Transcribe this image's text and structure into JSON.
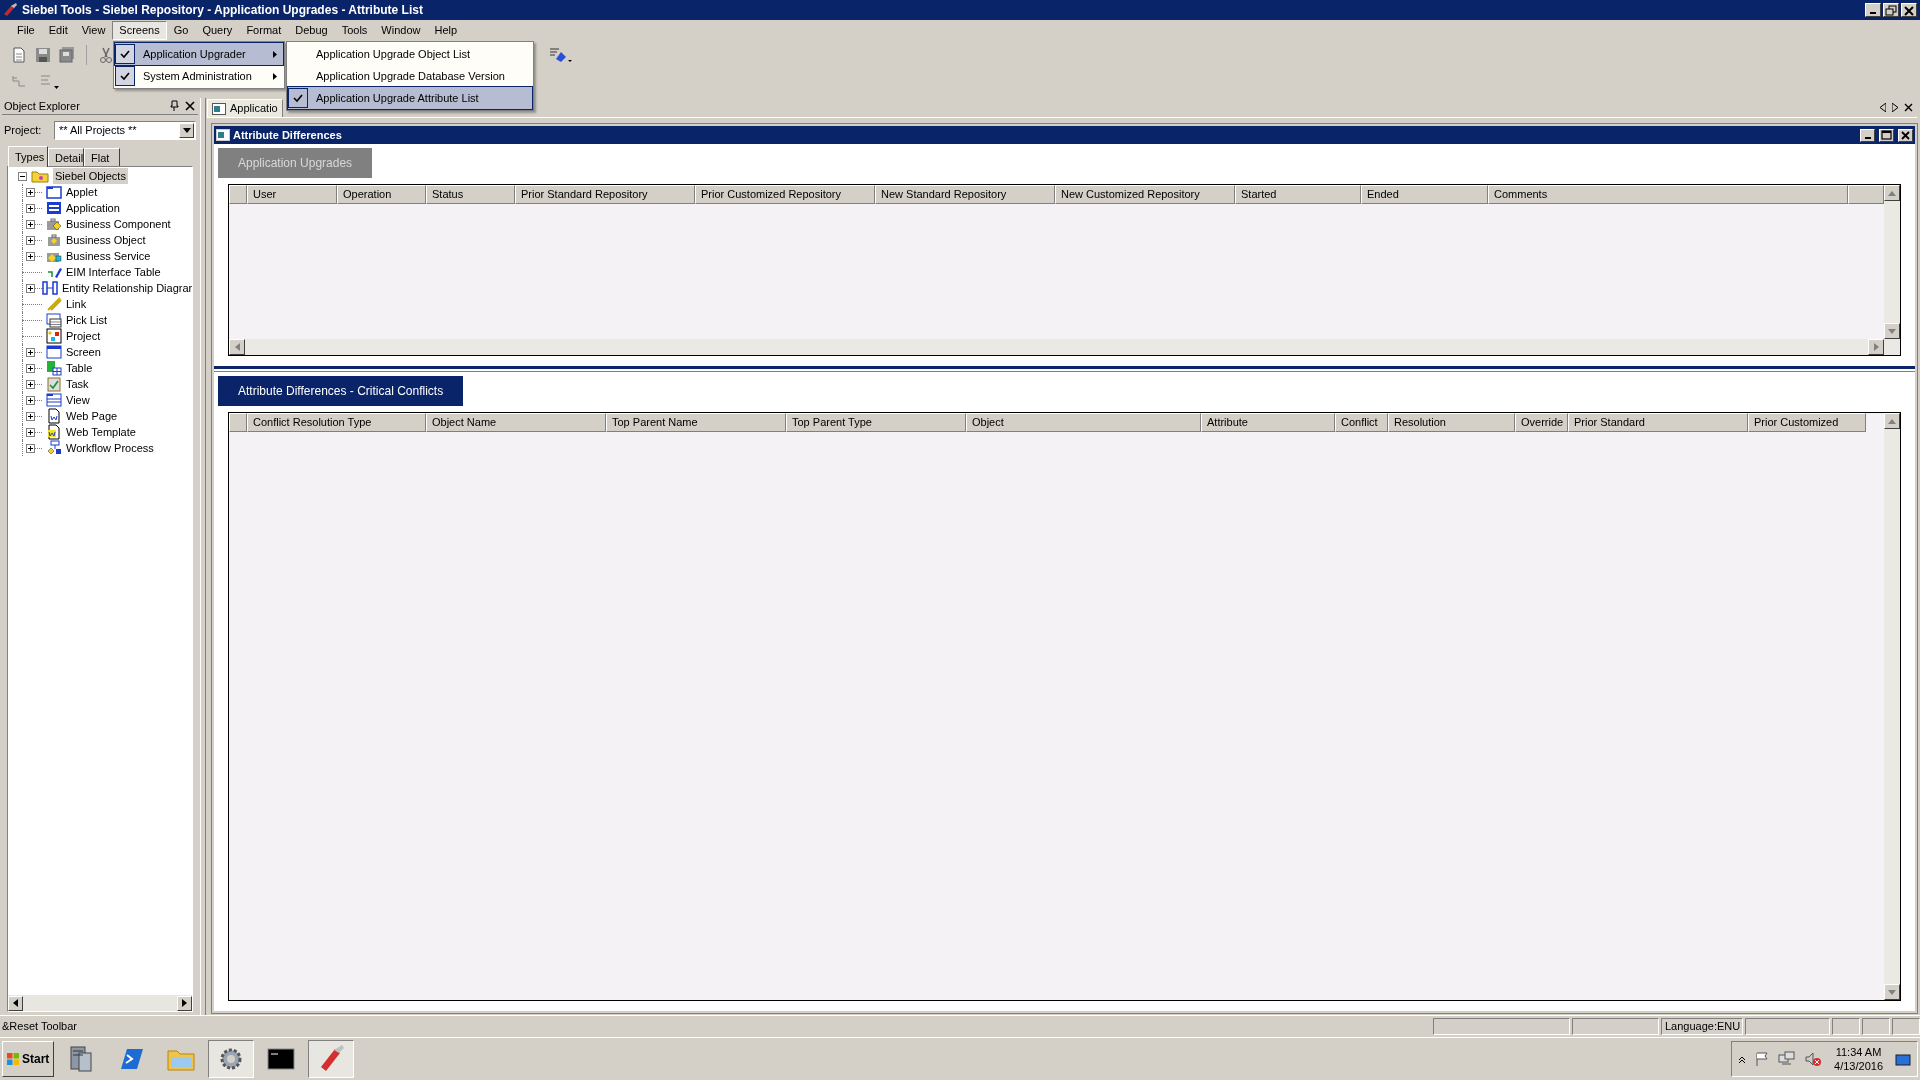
{
  "window": {
    "title": "Siebel Tools - Siebel Repository - Application Upgrades - Attribute List"
  },
  "menu_bar": [
    {
      "label": "File",
      "selected": false
    },
    {
      "label": "Edit",
      "selected": false
    },
    {
      "label": "View",
      "selected": false
    },
    {
      "label": "Screens",
      "selected": true
    },
    {
      "label": "Go",
      "selected": false
    },
    {
      "label": "Query",
      "selected": false
    },
    {
      "label": "Format",
      "selected": false
    },
    {
      "label": "Debug",
      "selected": false
    },
    {
      "label": "Tools",
      "selected": false
    },
    {
      "label": "Window",
      "selected": false
    },
    {
      "label": "Help",
      "selected": false
    }
  ],
  "screens_menu": [
    {
      "label": "Application Upgrader",
      "checked": true,
      "selected": true,
      "has_submenu": true
    },
    {
      "label": "System Administration",
      "checked": true,
      "selected": false,
      "has_submenu": true
    }
  ],
  "submenu": [
    {
      "label": "Application Upgrade Object List",
      "checked": false,
      "selected": false
    },
    {
      "label": "Application Upgrade Database Version",
      "checked": false,
      "selected": false
    },
    {
      "label": "Application Upgrade Attribute List",
      "checked": true,
      "selected": true
    }
  ],
  "object_explorer": {
    "title": "Object Explorer",
    "project_label": "Project:",
    "project_value": "** All Projects **",
    "tabs": [
      {
        "label": "Types",
        "selected": true
      },
      {
        "label": "Detail",
        "selected": false
      },
      {
        "label": "Flat",
        "selected": false
      }
    ],
    "tree": [
      {
        "label": "Siebel Objects",
        "expanded": true,
        "selected": true,
        "children": [
          {
            "label": "Applet",
            "expandable": true
          },
          {
            "label": "Application",
            "expandable": true
          },
          {
            "label": "Business Component",
            "expandable": true
          },
          {
            "label": "Business Object",
            "expandable": true
          },
          {
            "label": "Business Service",
            "expandable": true
          },
          {
            "label": "EIM Interface Table",
            "expandable": false
          },
          {
            "label": "Entity Relationship Diagrar",
            "expandable": true
          },
          {
            "label": "Link",
            "expandable": false
          },
          {
            "label": "Pick List",
            "expandable": false
          },
          {
            "label": "Project",
            "expandable": false
          },
          {
            "label": "Screen",
            "expandable": true
          },
          {
            "label": "Table",
            "expandable": true
          },
          {
            "label": "Task",
            "expandable": true
          },
          {
            "label": "View",
            "expandable": true
          },
          {
            "label": "Web Page",
            "expandable": true
          },
          {
            "label": "Web Template",
            "expandable": true
          },
          {
            "label": "Workflow Process",
            "expandable": true
          }
        ]
      }
    ]
  },
  "document_tab": {
    "label": "Applicatio"
  },
  "view": {
    "title": "Attribute Differences",
    "applets": [
      {
        "tab": {
          "label": "Application Upgrades",
          "active": false
        },
        "columns": [
          "User",
          "Operation",
          "Status",
          "Prior Standard Repository",
          "Prior Customized Repository",
          "New Standard Repository",
          "New Customized Repository",
          "Started",
          "Ended",
          "Comments"
        ]
      },
      {
        "tab": {
          "label": "Attribute Differences - Critical Conflicts",
          "active": true
        },
        "columns": [
          "Conflict Resolution Type",
          "Object Name",
          "Top Parent Name",
          "Top Parent Type",
          "Object",
          "Attribute",
          "Conflict",
          "Resolution",
          "Override",
          "Prior Standard",
          "Prior Customized"
        ]
      }
    ]
  },
  "status_bar": {
    "message": "&Reset Toolbar",
    "language": "Language:ENU"
  },
  "taskbar": {
    "start": "Start",
    "time": "11:34 AM",
    "date": "4/13/2016"
  }
}
